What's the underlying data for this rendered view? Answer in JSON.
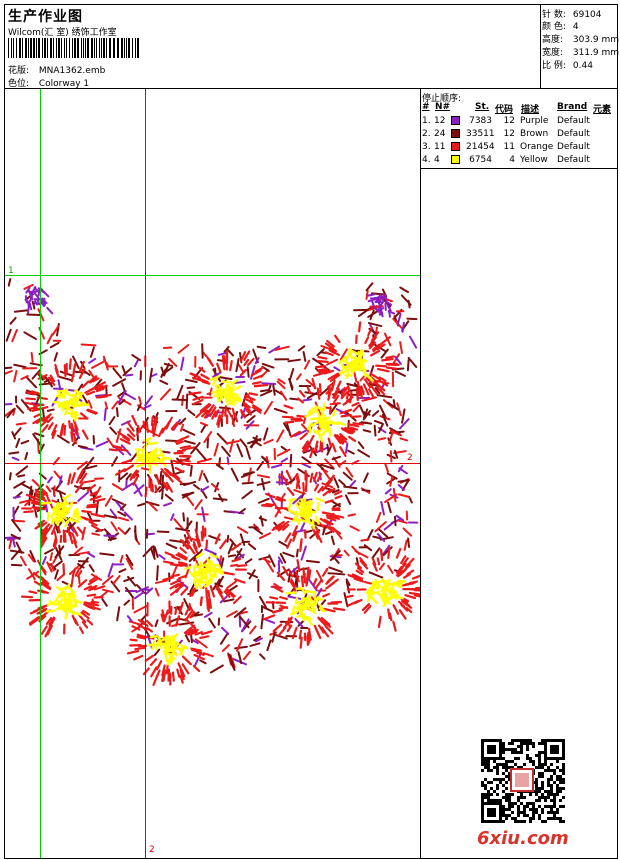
{
  "header": {
    "title": "生产作业图",
    "studio": "Wilcom(汇 室) 绣饰工作室",
    "design_label": "花版:",
    "design_value": "MNA1362.emb",
    "colorway_label": "色位:",
    "colorway_value": "Colorway 1"
  },
  "specs": [
    {
      "label": "针 数:",
      "value": "69104"
    },
    {
      "label": "颜 色:",
      "value": "4"
    },
    {
      "label": "高度:",
      "value": "303.9 mm"
    },
    {
      "label": "宽度:",
      "value": "311.9 mm"
    },
    {
      "label": "比 例:",
      "value": "0.44"
    }
  ],
  "stops": {
    "title": "停止顺序:",
    "headers": {
      "num": "#",
      "no": "N#",
      "st": "St.",
      "code": "代码",
      "desc": "描述",
      "brand": "Brand",
      "element": "元素"
    },
    "rows": [
      {
        "idx": "1.",
        "no": "12",
        "color": "#8b1fc6",
        "st": "7383",
        "code": "12",
        "desc": "Purple",
        "brand": "Default"
      },
      {
        "idx": "2.",
        "no": "24",
        "color": "#7a0e0e",
        "st": "33511",
        "code": "12",
        "desc": "Brown",
        "brand": "Default"
      },
      {
        "idx": "3.",
        "no": "11",
        "color": "#ec1a1a",
        "st": "21454",
        "code": "11",
        "desc": "Orange",
        "brand": "Default"
      },
      {
        "idx": "4.",
        "no": "4",
        "color": "#ffff00",
        "st": "6754",
        "code": "4",
        "desc": "Yellow",
        "brand": "Default"
      }
    ]
  },
  "guides": {
    "h1_label": "1",
    "h2_label": "2",
    "v2_label": "2"
  },
  "colors": {
    "purple": "#8b1fc6",
    "brown": "#7a0e0e",
    "red": "#ec1a1a",
    "yellow": "#ffff00",
    "guide_green": "#00d000",
    "guide_red": "#e00000"
  },
  "footer": {
    "watermark": "6xiu.com"
  }
}
